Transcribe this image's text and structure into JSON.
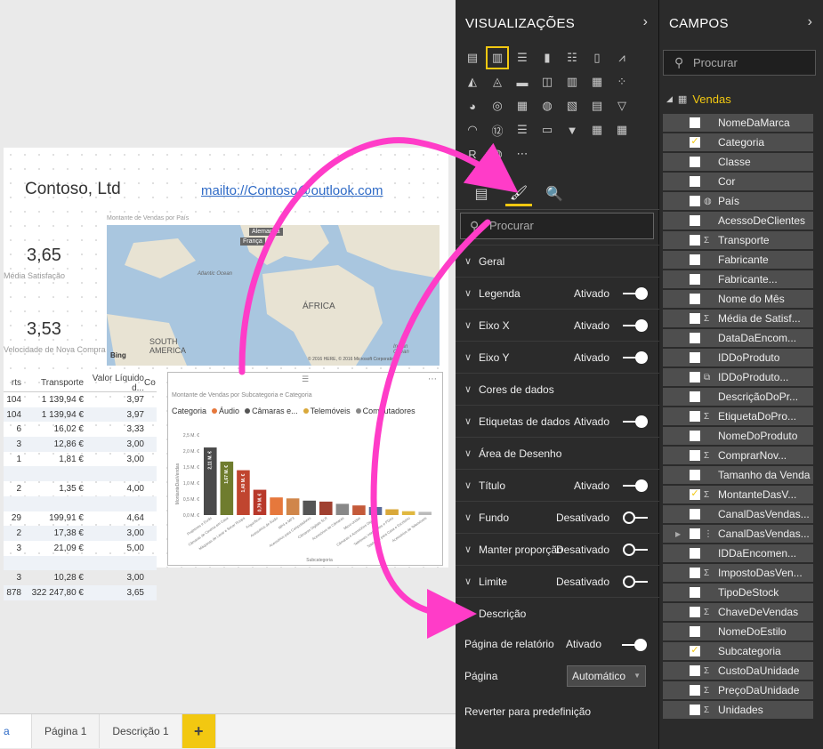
{
  "report": {
    "company": "Contoso, Ltd",
    "email": "mailto://Contoso@outlook.com",
    "kpi1_value": "3,65",
    "kpi1_label": "Média Satisfação",
    "kpi2_value": "3,53",
    "kpi2_label": "Velocidade de Nova Compra",
    "map_caption": "Montante de Vendas por País",
    "map_labels": {
      "germany": "Alemanha",
      "france": "França",
      "africa": "ÁFRICA",
      "south_america": "SOUTH AMERICA",
      "atlantic": "Atlantic Ocean",
      "indian": "Indian Ocean",
      "bing": "Bing",
      "copyright": "© 2016 HERE, © 2016 Microsoft Corporation"
    },
    "table": {
      "headers": [
        "rts",
        "Transporte",
        "Valor Líquido d...",
        "Co"
      ],
      "rows": [
        [
          "104",
          "1 139,94 €",
          "3,97"
        ],
        [
          "104",
          "1 139,94 €",
          "3,97"
        ],
        [
          "6",
          "16,02 €",
          "3,33"
        ],
        [
          "3",
          "12,86 €",
          "3,00"
        ],
        [
          "1",
          "1,81 €",
          "3,00"
        ],
        [
          "",
          "",
          " "
        ],
        [
          "2",
          "1,35 €",
          "4,00"
        ],
        [
          "",
          "",
          " "
        ],
        [
          "29",
          "199,91 €",
          "4,64"
        ],
        [
          "2",
          "17,38 €",
          "3,00"
        ],
        [
          "3",
          "21,09 €",
          "5,00"
        ],
        [
          "",
          "",
          " "
        ],
        [
          "3",
          "10,28 €",
          "3,00"
        ],
        [
          "878",
          "322 247,80 €",
          "3,65"
        ]
      ]
    }
  },
  "chart_data": {
    "type": "bar",
    "title": "Montante de Vendas por Subcategoria e Categoria",
    "xlabel": "Subcategoria",
    "ylabel": "MontanteDasVendas",
    "legend_title": "Categoria",
    "legend": [
      {
        "name": "Áudio",
        "color": "#e6783c"
      },
      {
        "name": "Câmaras e...",
        "color": "#555555"
      },
      {
        "name": "Telemóveis",
        "color": "#d9a83a"
      },
      {
        "name": "Computadores",
        "color": "#888888"
      }
    ],
    "yticks": [
      "0,0 M. €",
      "0,5 M. €",
      "1,0 M. €",
      "1,5 M. €",
      "2,0 M. €",
      "2,5 M. €"
    ],
    "ylim": [
      0,
      2.5
    ],
    "categories": [
      "Projetores e Ecrãs",
      "Câmaras de Cinema em Casa",
      "Máquinas de Lavar e Secar Roupa",
      "Frigoríficos",
      "Acessórios de Áudio",
      "MP4 e MP3",
      "Acessórios para Computadores",
      "Câmaras Digitais SLR",
      "Acessórios de Câmaras",
      "Micro-ondas",
      "Câmaras e Acessórios Digitais",
      "Telefones Inteligentes e PDAs",
      "Telefones para Casa e Escritório",
      "Acessórios de Telemóveis"
    ],
    "values": [
      2.11,
      1.67,
      1.4,
      0.79,
      0.55,
      0.52,
      0.45,
      0.42,
      0.35,
      0.3,
      0.25,
      0.18,
      0.12,
      0.1
    ],
    "colors": [
      "#4a4a4a",
      "#6f7c2e",
      "#c0452f",
      "#b8382a",
      "#e6783c",
      "#d0864a",
      "#555",
      "#a04030",
      "#888",
      "#c45a3a",
      "#5a6b9a",
      "#d9a83a",
      "#e0b840",
      "#bbb"
    ],
    "labels": [
      "2,11 M. €",
      "1,67 M. €",
      "1,40 M. €",
      "0,79 M. €"
    ]
  },
  "tabs": [
    "a",
    "Página 1",
    "Descrição 1",
    "+"
  ],
  "viz": {
    "title": "VISUALIZAÇÕES",
    "search_placeholder": "Procurar",
    "sections": [
      {
        "label": "Geral",
        "state": "",
        "toggle": "none",
        "expanded": false
      },
      {
        "label": "Legenda",
        "state": "Ativado",
        "toggle": "on",
        "expanded": false
      },
      {
        "label": "Eixo X",
        "state": "Ativado",
        "toggle": "on",
        "expanded": false
      },
      {
        "label": "Eixo Y",
        "state": "Ativado",
        "toggle": "on",
        "expanded": false
      },
      {
        "label": "Cores de dados",
        "state": "",
        "toggle": "none",
        "expanded": false
      },
      {
        "label": "Etiquetas de dados",
        "state": "Ativado",
        "toggle": "on",
        "expanded": false
      },
      {
        "label": "Área de Desenho",
        "state": "",
        "toggle": "none",
        "expanded": false
      },
      {
        "label": "Título",
        "state": "Ativado",
        "toggle": "on",
        "expanded": false
      },
      {
        "label": "Fundo",
        "state": "Desativado",
        "toggle": "off",
        "expanded": false
      },
      {
        "label": "Manter proporção",
        "state": "Desativado",
        "toggle": "off",
        "expanded": false
      },
      {
        "label": "Limite",
        "state": "Desativado",
        "toggle": "off",
        "expanded": false
      },
      {
        "label": "Descrição",
        "state": "",
        "toggle": "none",
        "expanded": true
      }
    ],
    "desc_report_label": "Página de relatório",
    "desc_report_state": "Ativado",
    "desc_page_label": "Página",
    "desc_page_value": "Automático",
    "reset_label": "Reverter para predefinição"
  },
  "campos": {
    "title": "CAMPOS",
    "search_placeholder": "Procurar",
    "table_name": "Vendas",
    "fields": [
      {
        "name": "NomeDaMarca",
        "checked": false,
        "sigma": false
      },
      {
        "name": "Categoria",
        "checked": true,
        "sigma": false
      },
      {
        "name": "Classe",
        "checked": false,
        "sigma": false
      },
      {
        "name": "Cor",
        "checked": false,
        "sigma": false
      },
      {
        "name": "País",
        "checked": false,
        "sigma": false,
        "globe": true
      },
      {
        "name": "AcessoDeClientes",
        "checked": false,
        "sigma": false
      },
      {
        "name": "Transporte",
        "checked": false,
        "sigma": true
      },
      {
        "name": "Fabricante",
        "checked": false,
        "sigma": false
      },
      {
        "name": "Fabricante...",
        "checked": false,
        "sigma": false
      },
      {
        "name": "Nome do Mês",
        "checked": false,
        "sigma": false
      },
      {
        "name": "Média de Satisf...",
        "checked": false,
        "sigma": true
      },
      {
        "name": "DataDaEncom...",
        "checked": false,
        "sigma": false
      },
      {
        "name": "IDDoProduto",
        "checked": false,
        "sigma": false
      },
      {
        "name": "IDDoProduto...",
        "checked": false,
        "sigma": false,
        "link": true
      },
      {
        "name": "DescriçãoDoPr...",
        "checked": false,
        "sigma": false
      },
      {
        "name": "EtiquetaDoPro...",
        "checked": false,
        "sigma": true
      },
      {
        "name": "NomeDoProduto",
        "checked": false,
        "sigma": false
      },
      {
        "name": "ComprarNov...",
        "checked": false,
        "sigma": true
      },
      {
        "name": "Tamanho da Venda",
        "checked": false,
        "sigma": false
      },
      {
        "name": "MontanteDasV...",
        "checked": true,
        "sigma": true
      },
      {
        "name": "CanalDasVendas...",
        "checked": false,
        "sigma": false
      },
      {
        "name": "CanalDasVendas...",
        "checked": false,
        "sigma": false,
        "hier": true
      },
      {
        "name": "IDDaEncomen...",
        "checked": false,
        "sigma": false
      },
      {
        "name": "ImpostoDasVen...",
        "checked": false,
        "sigma": true
      },
      {
        "name": "TipoDeStock",
        "checked": false,
        "sigma": false
      },
      {
        "name": "ChaveDeVendas",
        "checked": false,
        "sigma": true
      },
      {
        "name": "NomeDoEstilo",
        "checked": false,
        "sigma": false
      },
      {
        "name": "Subcategoria",
        "checked": true,
        "sigma": false
      },
      {
        "name": "CustoDaUnidade",
        "checked": false,
        "sigma": true
      },
      {
        "name": "PreçoDaUnidade",
        "checked": false,
        "sigma": true
      },
      {
        "name": "Unidades",
        "checked": false,
        "sigma": true
      }
    ]
  },
  "colors": {
    "accent": "#f2c811",
    "arrow": "#ff3cc8",
    "pane": "#2b2b2b"
  }
}
